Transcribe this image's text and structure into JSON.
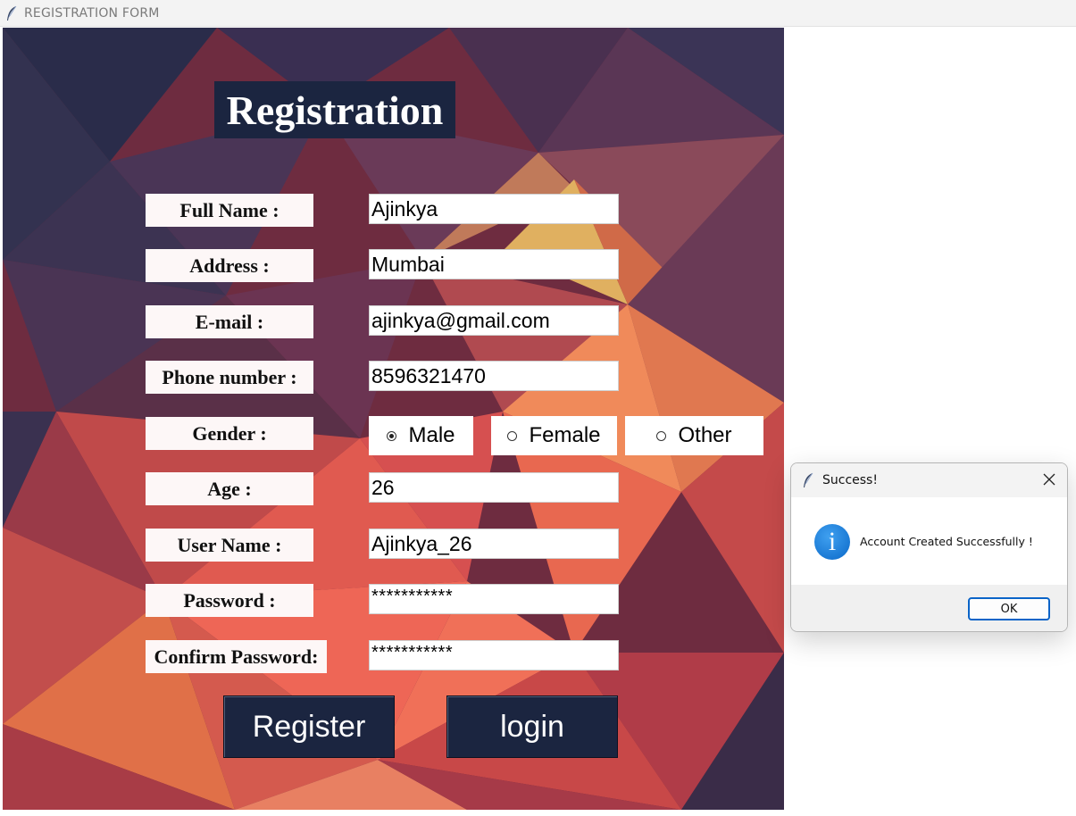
{
  "window": {
    "title": "REGISTRATION FORM",
    "icon": "feather-icon"
  },
  "form": {
    "heading": "Registration",
    "fields": {
      "full_name": {
        "label": "Full Name :",
        "value": "Ajinkya"
      },
      "address": {
        "label": "Address :",
        "value": "Mumbai"
      },
      "email": {
        "label": "E-mail :",
        "value": "ajinkya@gmail.com"
      },
      "phone": {
        "label": "Phone number :",
        "value": "8596321470"
      },
      "gender": {
        "label": "Gender :"
      },
      "age": {
        "label": "Age :",
        "value": "26"
      },
      "username": {
        "label": "User Name :",
        "value": "Ajinkya_26"
      },
      "password": {
        "label": "Password :",
        "value": "***********"
      },
      "confirm_password": {
        "label": "Confirm Password:",
        "value": "***********"
      }
    },
    "gender_options": [
      {
        "label": "Male",
        "selected": true
      },
      {
        "label": "Female",
        "selected": false
      },
      {
        "label": "Other",
        "selected": false
      }
    ],
    "buttons": {
      "register": "Register",
      "login": "login"
    }
  },
  "dialog": {
    "title": "Success!",
    "icon": "info-icon",
    "message": "Account Created Successfully !",
    "ok_label": "OK"
  },
  "colors": {
    "dark_navy": "#1b2540",
    "label_bg": "#fdf7f7",
    "accent_blue": "#0a64c8"
  }
}
